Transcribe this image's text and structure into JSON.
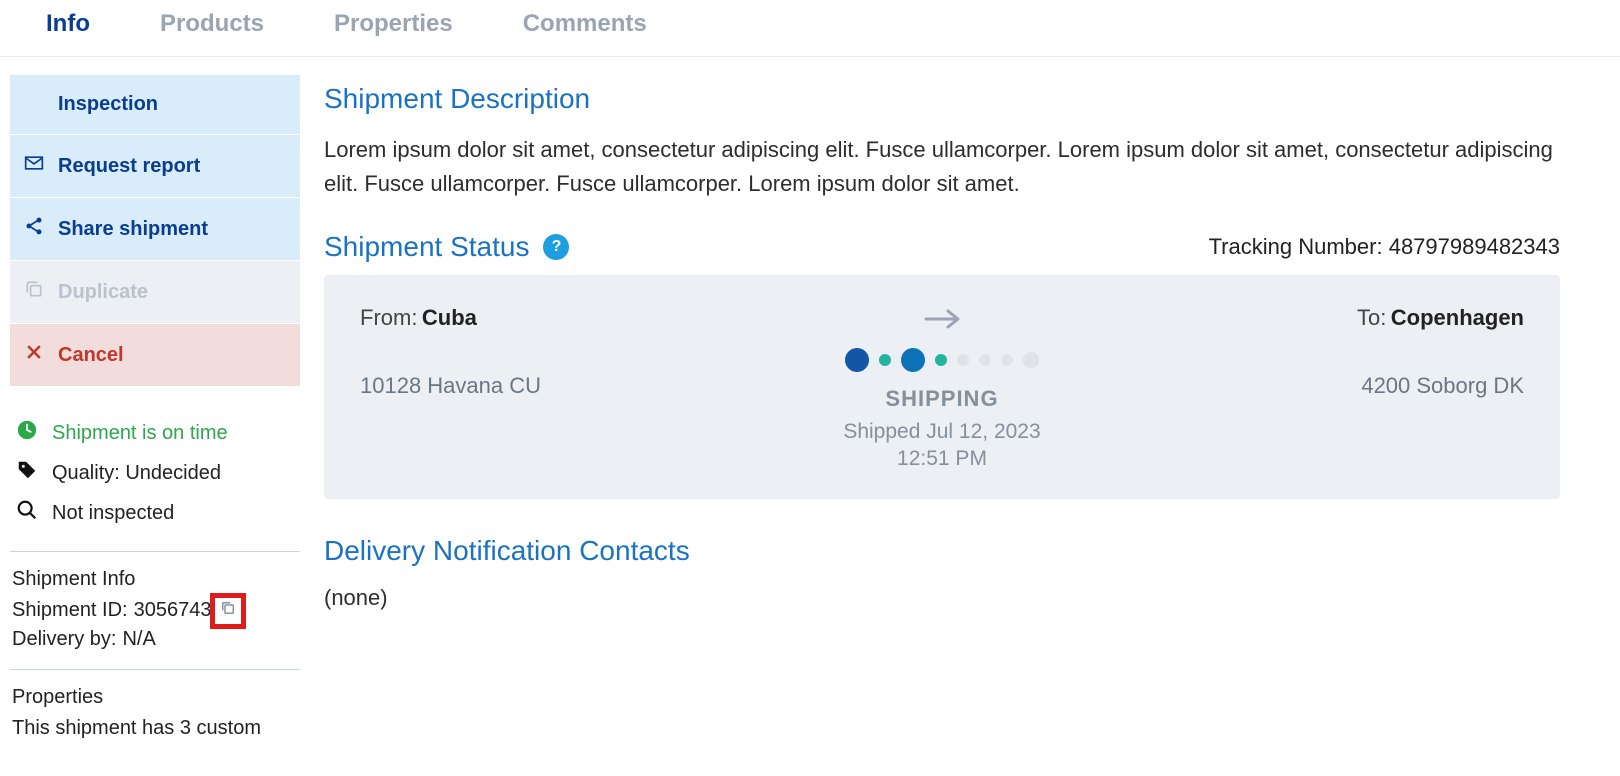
{
  "tabs": {
    "info": "Info",
    "products": "Products",
    "properties": "Properties",
    "comments": "Comments",
    "active": "info"
  },
  "sidebar": {
    "actions": {
      "inspection": "Inspection",
      "request_report": "Request report",
      "share_shipment": "Share shipment",
      "duplicate": "Duplicate",
      "cancel": "Cancel"
    },
    "status": {
      "on_time": "Shipment is on time",
      "quality": "Quality: Undecided",
      "inspected": "Not inspected"
    },
    "info": {
      "title": "Shipment Info",
      "id_label": "Shipment ID:",
      "id_value": "3056743",
      "delivery_label": "Delivery by:",
      "delivery_value": "N/A"
    },
    "properties": {
      "title": "Properties",
      "line": "This shipment has 3 custom"
    }
  },
  "main": {
    "description": {
      "heading": "Shipment Description",
      "text": "Lorem ipsum dolor sit amet, consectetur adipiscing elit. Fusce ullamcorper. Lorem ipsum dolor sit amet, consectetur adipiscing elit. Fusce ullamcorper. Fusce ullamcorper. Lorem ipsum dolor sit amet."
    },
    "status": {
      "heading": "Shipment Status",
      "tracking_label": "Tracking Number:",
      "tracking_value": "48797989482343",
      "from_label": "From:",
      "from_value": "Cuba",
      "from_addr": "10128 Havana CU",
      "to_label": "To:",
      "to_value": "Copenhagen",
      "to_addr": "4200 Soborg DK",
      "state": "SHIPPING",
      "state_line1": "Shipped Jul 12, 2023",
      "state_line2": "12:51 PM"
    },
    "contacts": {
      "heading": "Delivery Notification Contacts",
      "value": "(none)"
    }
  }
}
